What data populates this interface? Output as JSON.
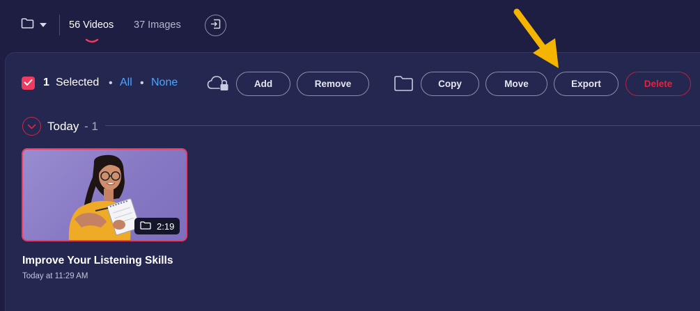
{
  "topbar": {
    "tabs": [
      {
        "label": "56 Videos",
        "active": true
      },
      {
        "label": "37 Images",
        "active": false
      }
    ]
  },
  "selection": {
    "count": "1",
    "label": "Selected",
    "separator": "•",
    "all_label": "All",
    "none_label": "None"
  },
  "actions": {
    "add": "Add",
    "remove": "Remove",
    "copy": "Copy",
    "move": "Move",
    "export": "Export",
    "delete": "Delete"
  },
  "group": {
    "title": "Today",
    "count": "- 1"
  },
  "items": [
    {
      "title": "Improve Your Listening Skills",
      "date": "Today at 11:29 AM",
      "duration": "2:19",
      "selected": true
    }
  ],
  "colors": {
    "accent": "#ef3b5e",
    "link": "#4ea4ff",
    "delete": "#e3223f",
    "annotation_arrow": "#f5b400"
  },
  "icons": [
    "folder-icon",
    "chevron-down-icon",
    "exit-icon",
    "check-icon",
    "cloud-lock-icon",
    "folder-icon",
    "arrow-annotation-icon"
  ]
}
